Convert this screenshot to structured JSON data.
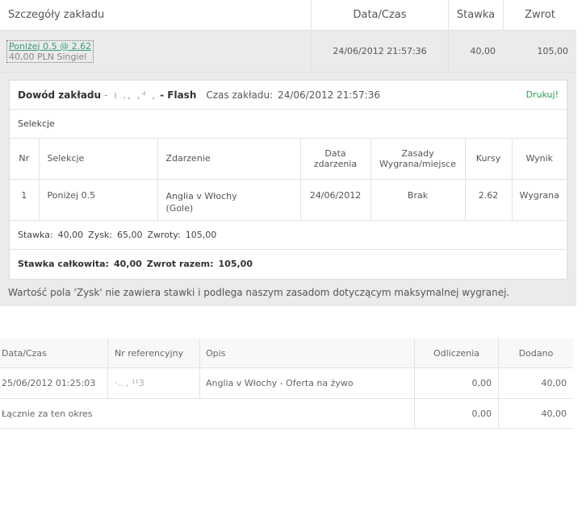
{
  "summary": {
    "headers": {
      "details": "Szczegóły zakładu",
      "datetime": "Data/Czas",
      "stake": "Stawka",
      "return": "Zwrot"
    },
    "bet": {
      "selection": "Poniżej  0.5 @ 2.62",
      "type": "40,00 PLN Singiel",
      "datetime": "24/06/2012 21:57:36",
      "stake": "40,00",
      "return": "105,00"
    }
  },
  "proof": {
    "title": "Dowód zakładu",
    "masked_id": "- ı ., ,ᵈ ,",
    "product": "- Flash",
    "time_label": "Czas zakładu:",
    "time_value": "24/06/2012 21:57:36",
    "print_label": "Drukuj!",
    "selections_label": "Selekcje",
    "columns": {
      "nr": "Nr",
      "selection": "Selekcje",
      "event": "Zdarzenie",
      "event_date": "Data zdarzenia",
      "rules": "Zasady Wygrana/miejsce",
      "odds": "Kursy",
      "result": "Wynik"
    },
    "row": {
      "nr": "1",
      "selection": "Poniżej 0.5",
      "event": "Anglia v Włochy (Gole)",
      "event_date": "24/06/2012",
      "rules": "Brak",
      "odds": "2.62",
      "result": "Wygrana"
    },
    "stake_line": {
      "stake_label": "Stawka:",
      "stake": "40,00",
      "profit_label": "Zysk:",
      "profit": "65,00",
      "returns_label": "Zwroty:",
      "returns": "105,00"
    },
    "totals": {
      "stake_label": "Stawka całkowita:",
      "stake": "40,00",
      "return_label": "Zwrot razem:",
      "return": "105,00"
    },
    "note": "Wartość pola 'Zysk' nie zawiera stawki i podlega naszym zasadom dotyczącym maksymalnej wygranej."
  },
  "transactions": {
    "headers": {
      "datetime": "Data/Czas",
      "ref": "Nr referencyjny",
      "desc": "Opis",
      "deductions": "Odliczenia",
      "added": "Dodano"
    },
    "row": {
      "datetime": "25/06/2012 01:25:03",
      "ref": "·.. ,   ¹¹3",
      "desc": "Anglia v Włochy - Oferta na żywo",
      "deductions": "0,00",
      "added": "40,00"
    },
    "total": {
      "label": "Łącznie za ten okres",
      "deductions": "0,00",
      "added": "40,00"
    }
  },
  "colors": {
    "link_green": "#3a9a7a",
    "print_green": "#2e9a5a",
    "panel_bg": "#ebebeb"
  }
}
